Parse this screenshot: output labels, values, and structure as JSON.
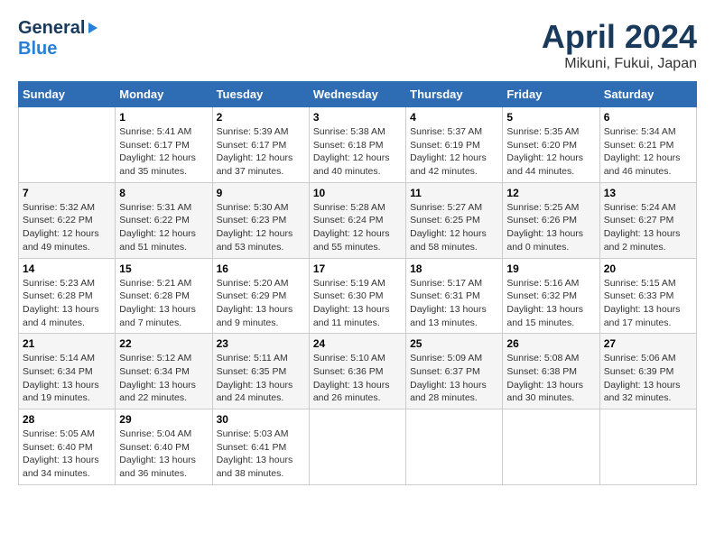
{
  "header": {
    "logo_line1": "General",
    "logo_line2": "Blue",
    "title": "April 2024",
    "location": "Mikuni, Fukui, Japan"
  },
  "weekdays": [
    "Sunday",
    "Monday",
    "Tuesday",
    "Wednesday",
    "Thursday",
    "Friday",
    "Saturday"
  ],
  "weeks": [
    [
      {
        "day": "",
        "sunrise": "",
        "sunset": "",
        "daylight": ""
      },
      {
        "day": "1",
        "sunrise": "Sunrise: 5:41 AM",
        "sunset": "Sunset: 6:17 PM",
        "daylight": "Daylight: 12 hours and 35 minutes."
      },
      {
        "day": "2",
        "sunrise": "Sunrise: 5:39 AM",
        "sunset": "Sunset: 6:17 PM",
        "daylight": "Daylight: 12 hours and 37 minutes."
      },
      {
        "day": "3",
        "sunrise": "Sunrise: 5:38 AM",
        "sunset": "Sunset: 6:18 PM",
        "daylight": "Daylight: 12 hours and 40 minutes."
      },
      {
        "day": "4",
        "sunrise": "Sunrise: 5:37 AM",
        "sunset": "Sunset: 6:19 PM",
        "daylight": "Daylight: 12 hours and 42 minutes."
      },
      {
        "day": "5",
        "sunrise": "Sunrise: 5:35 AM",
        "sunset": "Sunset: 6:20 PM",
        "daylight": "Daylight: 12 hours and 44 minutes."
      },
      {
        "day": "6",
        "sunrise": "Sunrise: 5:34 AM",
        "sunset": "Sunset: 6:21 PM",
        "daylight": "Daylight: 12 hours and 46 minutes."
      }
    ],
    [
      {
        "day": "7",
        "sunrise": "Sunrise: 5:32 AM",
        "sunset": "Sunset: 6:22 PM",
        "daylight": "Daylight: 12 hours and 49 minutes."
      },
      {
        "day": "8",
        "sunrise": "Sunrise: 5:31 AM",
        "sunset": "Sunset: 6:22 PM",
        "daylight": "Daylight: 12 hours and 51 minutes."
      },
      {
        "day": "9",
        "sunrise": "Sunrise: 5:30 AM",
        "sunset": "Sunset: 6:23 PM",
        "daylight": "Daylight: 12 hours and 53 minutes."
      },
      {
        "day": "10",
        "sunrise": "Sunrise: 5:28 AM",
        "sunset": "Sunset: 6:24 PM",
        "daylight": "Daylight: 12 hours and 55 minutes."
      },
      {
        "day": "11",
        "sunrise": "Sunrise: 5:27 AM",
        "sunset": "Sunset: 6:25 PM",
        "daylight": "Daylight: 12 hours and 58 minutes."
      },
      {
        "day": "12",
        "sunrise": "Sunrise: 5:25 AM",
        "sunset": "Sunset: 6:26 PM",
        "daylight": "Daylight: 13 hours and 0 minutes."
      },
      {
        "day": "13",
        "sunrise": "Sunrise: 5:24 AM",
        "sunset": "Sunset: 6:27 PM",
        "daylight": "Daylight: 13 hours and 2 minutes."
      }
    ],
    [
      {
        "day": "14",
        "sunrise": "Sunrise: 5:23 AM",
        "sunset": "Sunset: 6:28 PM",
        "daylight": "Daylight: 13 hours and 4 minutes."
      },
      {
        "day": "15",
        "sunrise": "Sunrise: 5:21 AM",
        "sunset": "Sunset: 6:28 PM",
        "daylight": "Daylight: 13 hours and 7 minutes."
      },
      {
        "day": "16",
        "sunrise": "Sunrise: 5:20 AM",
        "sunset": "Sunset: 6:29 PM",
        "daylight": "Daylight: 13 hours and 9 minutes."
      },
      {
        "day": "17",
        "sunrise": "Sunrise: 5:19 AM",
        "sunset": "Sunset: 6:30 PM",
        "daylight": "Daylight: 13 hours and 11 minutes."
      },
      {
        "day": "18",
        "sunrise": "Sunrise: 5:17 AM",
        "sunset": "Sunset: 6:31 PM",
        "daylight": "Daylight: 13 hours and 13 minutes."
      },
      {
        "day": "19",
        "sunrise": "Sunrise: 5:16 AM",
        "sunset": "Sunset: 6:32 PM",
        "daylight": "Daylight: 13 hours and 15 minutes."
      },
      {
        "day": "20",
        "sunrise": "Sunrise: 5:15 AM",
        "sunset": "Sunset: 6:33 PM",
        "daylight": "Daylight: 13 hours and 17 minutes."
      }
    ],
    [
      {
        "day": "21",
        "sunrise": "Sunrise: 5:14 AM",
        "sunset": "Sunset: 6:34 PM",
        "daylight": "Daylight: 13 hours and 19 minutes."
      },
      {
        "day": "22",
        "sunrise": "Sunrise: 5:12 AM",
        "sunset": "Sunset: 6:34 PM",
        "daylight": "Daylight: 13 hours and 22 minutes."
      },
      {
        "day": "23",
        "sunrise": "Sunrise: 5:11 AM",
        "sunset": "Sunset: 6:35 PM",
        "daylight": "Daylight: 13 hours and 24 minutes."
      },
      {
        "day": "24",
        "sunrise": "Sunrise: 5:10 AM",
        "sunset": "Sunset: 6:36 PM",
        "daylight": "Daylight: 13 hours and 26 minutes."
      },
      {
        "day": "25",
        "sunrise": "Sunrise: 5:09 AM",
        "sunset": "Sunset: 6:37 PM",
        "daylight": "Daylight: 13 hours and 28 minutes."
      },
      {
        "day": "26",
        "sunrise": "Sunrise: 5:08 AM",
        "sunset": "Sunset: 6:38 PM",
        "daylight": "Daylight: 13 hours and 30 minutes."
      },
      {
        "day": "27",
        "sunrise": "Sunrise: 5:06 AM",
        "sunset": "Sunset: 6:39 PM",
        "daylight": "Daylight: 13 hours and 32 minutes."
      }
    ],
    [
      {
        "day": "28",
        "sunrise": "Sunrise: 5:05 AM",
        "sunset": "Sunset: 6:40 PM",
        "daylight": "Daylight: 13 hours and 34 minutes."
      },
      {
        "day": "29",
        "sunrise": "Sunrise: 5:04 AM",
        "sunset": "Sunset: 6:40 PM",
        "daylight": "Daylight: 13 hours and 36 minutes."
      },
      {
        "day": "30",
        "sunrise": "Sunrise: 5:03 AM",
        "sunset": "Sunset: 6:41 PM",
        "daylight": "Daylight: 13 hours and 38 minutes."
      },
      {
        "day": "",
        "sunrise": "",
        "sunset": "",
        "daylight": ""
      },
      {
        "day": "",
        "sunrise": "",
        "sunset": "",
        "daylight": ""
      },
      {
        "day": "",
        "sunrise": "",
        "sunset": "",
        "daylight": ""
      },
      {
        "day": "",
        "sunrise": "",
        "sunset": "",
        "daylight": ""
      }
    ]
  ]
}
